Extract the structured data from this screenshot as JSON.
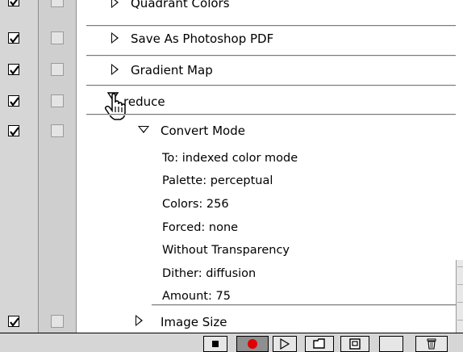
{
  "actions": [
    {
      "label": "Quadrant Colors",
      "checked": true,
      "expanded": false
    },
    {
      "label": "Save As Photoshop PDF",
      "checked": true,
      "expanded": false
    },
    {
      "label": "Gradient Map",
      "checked": true,
      "expanded": false
    },
    {
      "label": "reduce",
      "checked": true,
      "expanded": true
    }
  ],
  "command": {
    "label": "Convert Mode",
    "checked": true,
    "params": [
      "To: indexed color mode",
      "Palette: perceptual",
      "Colors: 256",
      "Forced: none",
      "Without Transparency",
      "Dither: diffusion",
      "Amount: 75"
    ]
  },
  "last_action": {
    "label": "Image Size",
    "checked": true,
    "expanded": false
  },
  "toolbar": {
    "buttons": [
      "stop-icon",
      "record-icon",
      "play-icon",
      "new-set-icon",
      "new-action-icon",
      "delete-icon"
    ],
    "record_color": "#e00000"
  },
  "cursor": "pointing-hand-cursor"
}
